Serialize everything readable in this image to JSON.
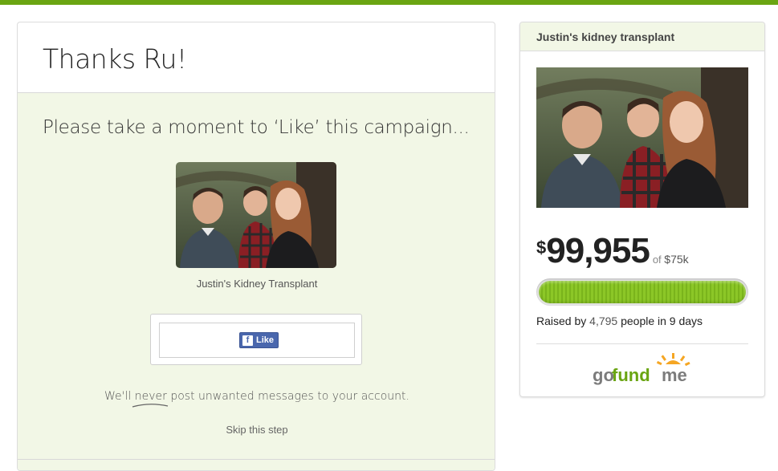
{
  "main": {
    "title": "Thanks Ru!",
    "prompt": "Please take a moment to ‘Like’ this campaign...",
    "photo_caption": "Justin's Kidney Transplant",
    "like_button": "Like",
    "notice_before": "We'll ",
    "notice_never": "never",
    "notice_after": " post unwanted messages to your account.",
    "skip_link": "Skip this step"
  },
  "sidebar": {
    "title": "Justin's kidney transplant",
    "currency": "$",
    "amount": "99,955",
    "of_label": "of",
    "goal": "$75k",
    "progress_fraction": 1.0,
    "raised_prefix": "Raised by ",
    "raised_count": "4,795",
    "raised_suffix": " people in 9 days",
    "logo_go": "go",
    "logo_fund": "fund",
    "logo_me": "me"
  },
  "colors": {
    "accent": "#6aa512",
    "panel_bg": "#f2f7e6",
    "facebook": "#4a67ad",
    "logo_orange": "#f5a623"
  }
}
